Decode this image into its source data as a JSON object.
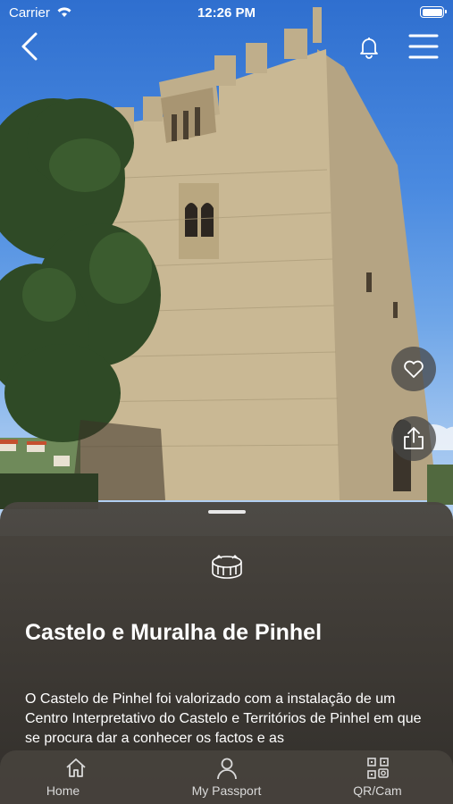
{
  "status_bar": {
    "carrier": "Carrier",
    "time": "12:26 PM"
  },
  "monument": {
    "title": "Castelo e Muralha de Pinhel",
    "description": "O Castelo de Pinhel foi valorizado com a instalação de um Centro Interpretativo do Castelo e Territórios de Pinhel em que se procura dar a conhecer os factos e as",
    "category_icon": "castle-ruins-icon"
  },
  "tabs": [
    {
      "label": "Home",
      "icon": "home-icon"
    },
    {
      "label": "My Passport",
      "icon": "user-icon"
    },
    {
      "label": "QR/Cam",
      "icon": "qr-camera-icon"
    }
  ],
  "colors": {
    "sheet": "#433f3a",
    "text": "#ffffff",
    "tab_label": "#d9d9d9",
    "sky": "#4a8ae0"
  }
}
